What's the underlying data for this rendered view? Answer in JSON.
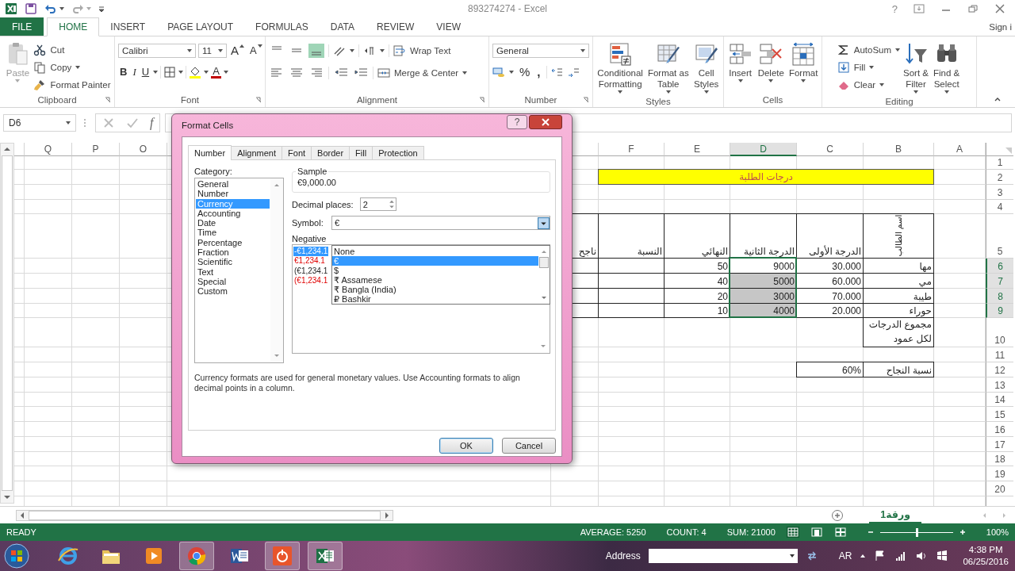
{
  "window": {
    "title": "893274274 - Excel",
    "help": "?"
  },
  "ribbon_tabs": [
    {
      "label": "FILE",
      "kind": "file",
      "selected": false
    },
    {
      "label": "HOME",
      "kind": "tab",
      "selected": true
    },
    {
      "label": "INSERT",
      "kind": "tab",
      "selected": false
    },
    {
      "label": "PAGE LAYOUT",
      "kind": "tab",
      "selected": false
    },
    {
      "label": "FORMULAS",
      "kind": "tab",
      "selected": false
    },
    {
      "label": "DATA",
      "kind": "tab",
      "selected": false
    },
    {
      "label": "REVIEW",
      "kind": "tab",
      "selected": false
    },
    {
      "label": "VIEW",
      "kind": "tab",
      "selected": false
    }
  ],
  "account": "Sign i",
  "ribbon": {
    "clipboard": {
      "label": "Clipboard",
      "paste": {
        "label": "Paste",
        "disabled": true
      },
      "cut": "Cut",
      "copy": "Copy",
      "format_painter": "Format Painter"
    },
    "font": {
      "label": "Font",
      "name": "Calibri",
      "size": "11",
      "grow": "A",
      "shrink": "A",
      "bold": "B",
      "italic": "I",
      "underline": "U",
      "font_color": "A"
    },
    "alignment": {
      "label": "Alignment",
      "vertical": [
        {
          "selected": false
        },
        {
          "selected": false
        },
        {
          "selected": true
        }
      ],
      "wrap_text": "Wrap Text",
      "merge": "Merge & Center"
    },
    "number": {
      "label": "Number",
      "format": "General",
      "percent": "%",
      "comma": ","
    },
    "styles": {
      "label": "Styles",
      "buttons": [
        {
          "kind": "conditional",
          "label": "Conditional\nFormatting"
        },
        {
          "kind": "table",
          "label": "Format as\nTable"
        },
        {
          "kind": "cellstyles",
          "label": "Cell\nStyles"
        }
      ]
    },
    "cells": {
      "label": "Cells",
      "buttons": [
        {
          "kind": "insert",
          "label": "Insert"
        },
        {
          "kind": "delete",
          "label": "Delete"
        },
        {
          "kind": "format",
          "label": "Format"
        }
      ]
    },
    "editing": {
      "label": "Editing",
      "autosum": "AutoSum",
      "fill": "Fill",
      "clear": "Clear",
      "sort": "Sort &\nFilter",
      "find": "Find &\nSelect"
    }
  },
  "formula_bar": {
    "name_box": "D6",
    "fx": "f"
  },
  "sheet": {
    "columns": [
      {
        "label": "Q",
        "selected": false
      },
      {
        "label": "P",
        "selected": false
      },
      {
        "label": "O",
        "selected": false
      },
      {
        "label": "F",
        "selected": false
      },
      {
        "label": "E",
        "selected": false
      },
      {
        "label": "D",
        "selected": true
      },
      {
        "label": "C",
        "selected": false
      },
      {
        "label": "B",
        "selected": false
      },
      {
        "label": "A",
        "selected": false
      }
    ],
    "rows": [
      {
        "label": "1",
        "selected": false
      },
      {
        "label": "2",
        "selected": false,
        "banner": "درجات الطلبة"
      },
      {
        "label": "3",
        "selected": false
      },
      {
        "label": "4",
        "selected": false
      },
      {
        "label": "5",
        "selected": false,
        "table": true,
        "cells": {
          "G": {
            "text": "ناجح",
            "kind": "text"
          },
          "F": {
            "text": "النسبة",
            "kind": "text"
          },
          "E": {
            "text": "النهائي",
            "kind": "text"
          },
          "D": {
            "text": "الدرجة الثانية",
            "kind": "text"
          },
          "C": {
            "text": "الدرجة الأولى",
            "kind": "text"
          },
          "B": {
            "text": "اسم الطالب",
            "kind": "rotated"
          }
        }
      },
      {
        "label": "6",
        "selected": true,
        "table": true,
        "cells": {
          "E": {
            "text": "50",
            "kind": "text"
          },
          "D": {
            "text": "9000",
            "kind": "text"
          },
          "C": {
            "text": "30.000",
            "kind": "text"
          },
          "B": {
            "text": "مها",
            "kind": "text"
          }
        }
      },
      {
        "label": "7",
        "selected": true,
        "table": true,
        "cells": {
          "E": {
            "text": "40",
            "kind": "text"
          },
          "D": {
            "text": "5000",
            "kind": "text"
          },
          "C": {
            "text": "60.000",
            "kind": "text"
          },
          "B": {
            "text": "مي",
            "kind": "text"
          }
        }
      },
      {
        "label": "8",
        "selected": true,
        "table": true,
        "cells": {
          "E": {
            "text": "20",
            "kind": "text"
          },
          "D": {
            "text": "3000",
            "kind": "text"
          },
          "C": {
            "text": "70.000",
            "kind": "text"
          },
          "B": {
            "text": "طيبة",
            "kind": "text"
          }
        }
      },
      {
        "label": "9",
        "selected": true,
        "table": true,
        "cells": {
          "E": {
            "text": "10",
            "kind": "text"
          },
          "D": {
            "text": "4000",
            "kind": "text"
          },
          "C": {
            "text": "20.000",
            "kind": "text"
          },
          "B": {
            "text": "حوراء",
            "kind": "text"
          }
        }
      },
      {
        "label": "10",
        "selected": false,
        "cells": {
          "B": {
            "text": "مجموع الدرجات\nلكل عمود",
            "kind": "wrap",
            "bordered": true
          }
        }
      },
      {
        "label": "11",
        "selected": false
      },
      {
        "label": "12",
        "selected": false,
        "cells": {
          "C": {
            "text": "60%",
            "kind": "text",
            "bordered": true
          },
          "B": {
            "text": "نسبة النجاح",
            "kind": "text",
            "bordered": true
          }
        }
      },
      {
        "label": "13",
        "selected": false
      },
      {
        "label": "14",
        "selected": false
      },
      {
        "label": "15",
        "selected": false
      },
      {
        "label": "16",
        "selected": false
      },
      {
        "label": "17",
        "selected": false
      },
      {
        "label": "18",
        "selected": false
      },
      {
        "label": "19",
        "selected": false
      },
      {
        "label": "20",
        "selected": false
      }
    ]
  },
  "sheet_tabs": [
    {
      "label": "ورقة1",
      "selected": true
    }
  ],
  "dialog": {
    "title": "Format Cells",
    "help": "?",
    "tabs": [
      {
        "label": "Number",
        "selected": true
      },
      {
        "label": "Alignment",
        "selected": false
      },
      {
        "label": "Font",
        "selected": false
      },
      {
        "label": "Border",
        "selected": false
      },
      {
        "label": "Fill",
        "selected": false
      },
      {
        "label": "Protection",
        "selected": false
      }
    ],
    "category_label": "Category:",
    "categories": [
      {
        "label": "General",
        "selected": false
      },
      {
        "label": "Number",
        "selected": false
      },
      {
        "label": "Currency",
        "selected": true
      },
      {
        "label": "Accounting",
        "selected": false
      },
      {
        "label": "Date",
        "selected": false
      },
      {
        "label": "Time",
        "selected": false
      },
      {
        "label": "Percentage",
        "selected": false
      },
      {
        "label": "Fraction",
        "selected": false
      },
      {
        "label": "Scientific",
        "selected": false
      },
      {
        "label": "Text",
        "selected": false
      },
      {
        "label": "Special",
        "selected": false
      },
      {
        "label": "Custom",
        "selected": false
      }
    ],
    "sample_label": "Sample",
    "sample": "€9,000.00",
    "decimal_label": "Decimal places:",
    "decimal_value": "2",
    "symbol_label": "Symbol:",
    "symbol_value": "€",
    "symbol_options": [
      {
        "label": "None",
        "selected": false
      },
      {
        "label": "€",
        "selected": true
      },
      {
        "label": "$",
        "selected": false
      },
      {
        "label": "₹ Assamese",
        "selected": false
      },
      {
        "label": "₹ Bangla (India)",
        "selected": false
      },
      {
        "label": "₽ Bashkir",
        "selected": false
      }
    ],
    "negative_label": "Negative",
    "negative_formats": [
      {
        "label": "-€1,234.1",
        "red": false,
        "selected": true
      },
      {
        "label": "€1,234.1",
        "red": true,
        "selected": false
      },
      {
        "label": "(€1,234.1",
        "red": false,
        "selected": false
      },
      {
        "label": "(€1,234.1",
        "red": true,
        "selected": false
      }
    ],
    "description": "Currency formats are used for general monetary values.  Use Accounting formats to align decimal points in a column.",
    "ok": "OK",
    "cancel": "Cancel"
  },
  "status_bar": {
    "ready": "READY",
    "average": "AVERAGE: 5250",
    "count": "COUNT: 4",
    "sum": "SUM: 21000",
    "views": [
      {
        "selected": true
      },
      {
        "selected": false
      },
      {
        "selected": false
      }
    ],
    "zoom": {
      "level": 0.5,
      "reading": "100%"
    }
  },
  "taskbar": {
    "apps": [
      {
        "kind": "ie",
        "running": false
      },
      {
        "kind": "folder",
        "running": false
      },
      {
        "kind": "media",
        "running": false
      },
      {
        "kind": "chrome",
        "running": true
      },
      {
        "kind": "word",
        "running": false
      },
      {
        "kind": "orange",
        "running": true
      },
      {
        "kind": "excel",
        "running": true
      }
    ],
    "address_label": "Address",
    "language": "AR",
    "time": "4:38 PM",
    "date": "06/25/2016"
  }
}
